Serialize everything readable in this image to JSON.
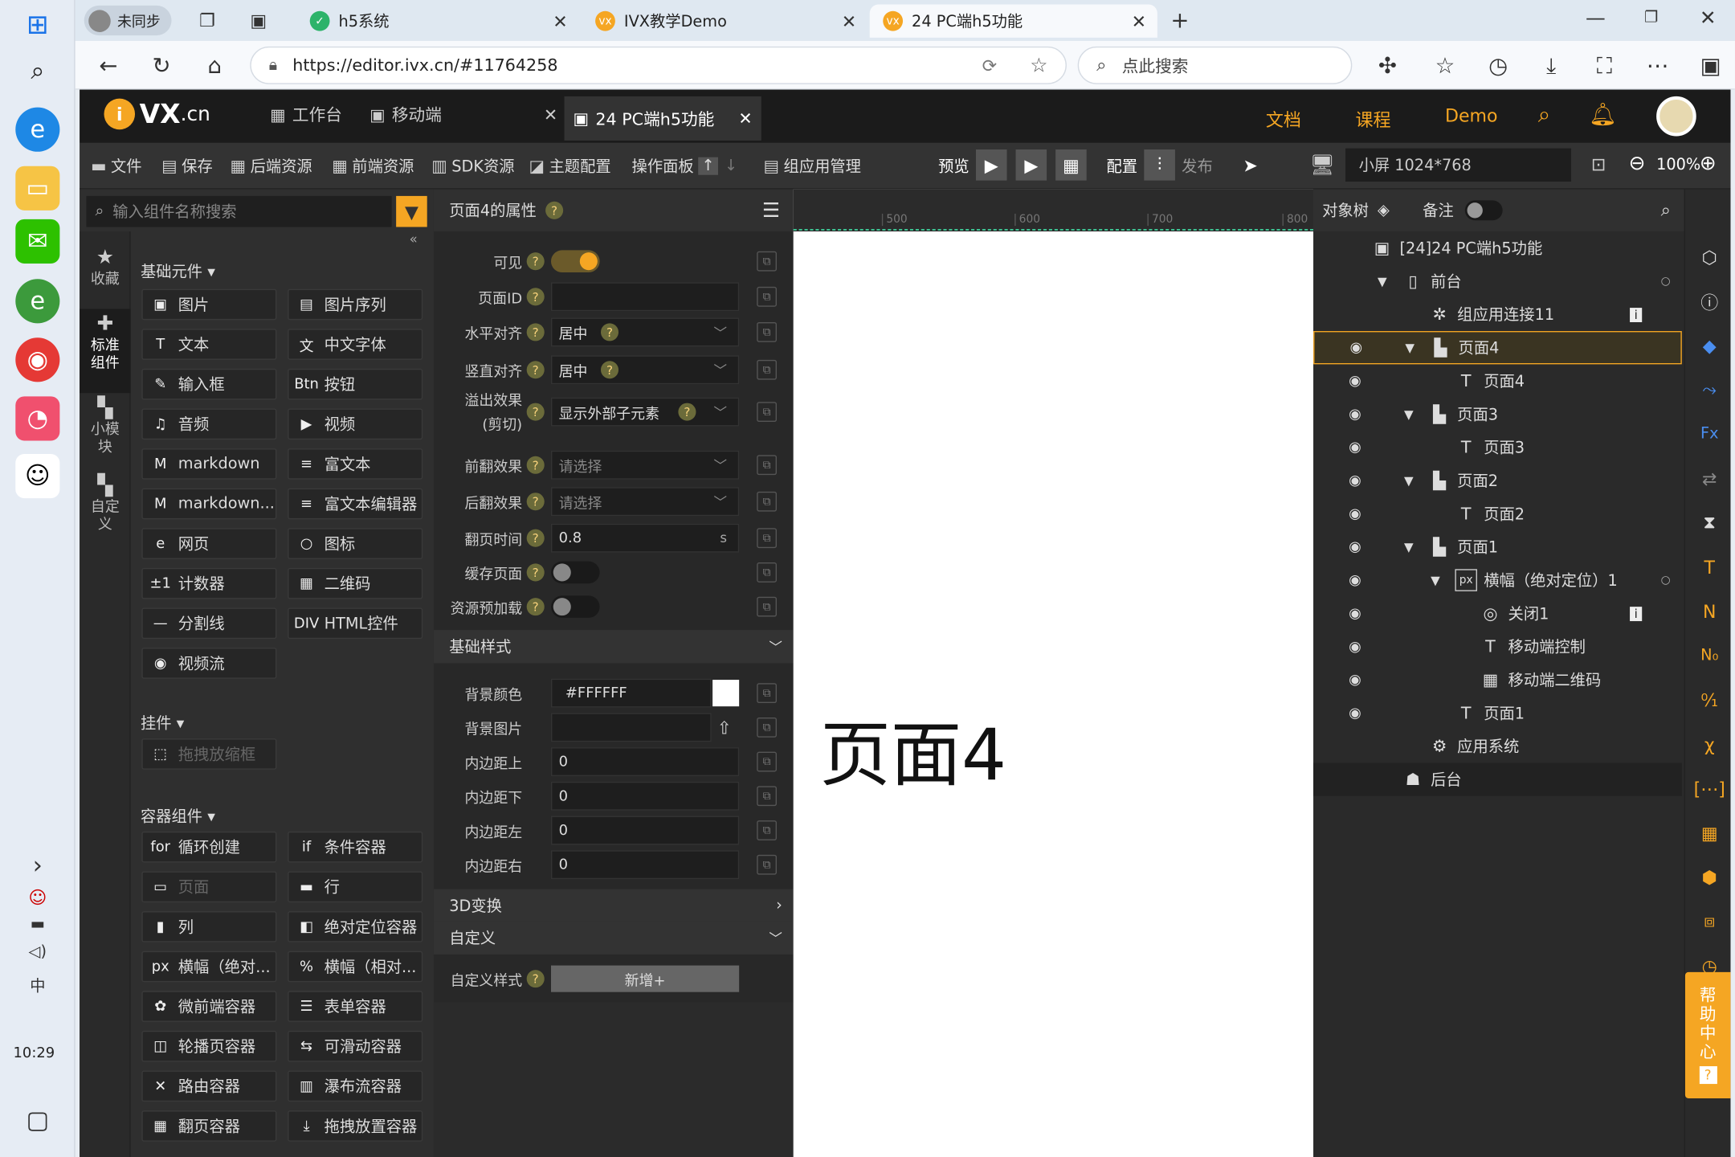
{
  "os": {
    "time": "10:29"
  },
  "browser": {
    "profile": "未同步",
    "tabs": [
      {
        "label": "h5系统"
      },
      {
        "label": "IVX教学Demo"
      },
      {
        "label": "24 PC端h5功能"
      }
    ],
    "url": "https://editor.ivx.cn/#11764258",
    "search_placeholder": "点此搜索"
  },
  "app": {
    "logo": "VX",
    "logo_suffix": ".cn",
    "header_tabs": [
      {
        "label": "工作台"
      },
      {
        "label": "移动端"
      },
      {
        "label": "24 PC端h5功能"
      }
    ],
    "header_links": [
      "文档",
      "课程",
      "Demo"
    ],
    "toolbar": {
      "file": "文件",
      "save": "保存",
      "backend": "后端资源",
      "frontend": "前端资源",
      "sdk": "SDK资源",
      "theme": "主题配置",
      "ops": "操作面板",
      "group": "组应用管理",
      "preview": "预览",
      "config": "配置",
      "publish": "发布",
      "screen": "小屏 1024*768",
      "zoom": "100%"
    },
    "search_placeholder": "输入组件名称搜索",
    "left_tabs": [
      {
        "label": "收藏"
      },
      {
        "label": "标准组件"
      },
      {
        "label": "小模块"
      },
      {
        "label": "自定义"
      }
    ],
    "sections": {
      "basic": "基础元件",
      "widgets": "挂件",
      "containers": "容器组件"
    },
    "basic_components": [
      {
        "label": "图片",
        "icon": "▣"
      },
      {
        "label": "图片序列",
        "icon": "▤"
      },
      {
        "label": "文本",
        "icon": "T"
      },
      {
        "label": "中文字体",
        "icon": "文"
      },
      {
        "label": "输入框",
        "icon": "✎"
      },
      {
        "label": "按钮",
        "icon": "Btn"
      },
      {
        "label": "音频",
        "icon": "♫"
      },
      {
        "label": "视频",
        "icon": "▶"
      },
      {
        "label": "markdown",
        "icon": "M"
      },
      {
        "label": "富文本",
        "icon": "≡"
      },
      {
        "label": "markdown...",
        "icon": "M"
      },
      {
        "label": "富文本编辑器",
        "icon": "≡"
      },
      {
        "label": "网页",
        "icon": "e"
      },
      {
        "label": "图标",
        "icon": "○"
      },
      {
        "label": "计数器",
        "icon": "±1"
      },
      {
        "label": "二维码",
        "icon": "▦"
      },
      {
        "label": "分割线",
        "icon": "—"
      },
      {
        "label": "HTML控件",
        "icon": "DIV"
      },
      {
        "label": "视频流",
        "icon": "◉"
      }
    ],
    "widget_components": [
      {
        "label": "拖拽放缩框",
        "icon": "⬚"
      }
    ],
    "container_components": [
      {
        "label": "循环创建",
        "icon": "for"
      },
      {
        "label": "条件容器",
        "icon": "if"
      },
      {
        "label": "页面",
        "icon": "▭"
      },
      {
        "label": "行",
        "icon": "▬"
      },
      {
        "label": "列",
        "icon": "▮"
      },
      {
        "label": "绝对定位容器",
        "icon": "◧"
      },
      {
        "label": "横幅（绝对...",
        "icon": "px"
      },
      {
        "label": "横幅（相对...",
        "icon": "%"
      },
      {
        "label": "微前端容器",
        "icon": "✿"
      },
      {
        "label": "表单容器",
        "icon": "☰"
      },
      {
        "label": "轮播页容器",
        "icon": "◫"
      },
      {
        "label": "可滑动容器",
        "icon": "⇆"
      },
      {
        "label": "路由容器",
        "icon": "✕"
      },
      {
        "label": "瀑布流容器",
        "icon": "▥"
      },
      {
        "label": "翻页容器",
        "icon": "▦"
      },
      {
        "label": "拖拽放置容器",
        "icon": "⤓"
      }
    ],
    "props": {
      "title": "页面4的属性",
      "visible": "可见",
      "page_id": "页面ID",
      "h_align": "水平对齐",
      "h_align_val": "居中",
      "v_align": "竖直对齐",
      "v_align_val": "居中",
      "overflow": "溢出效果",
      "overflow_sub": "(剪切)",
      "overflow_val": "显示外部子元素",
      "front_flip": "前翻效果",
      "back_flip": "后翻效果",
      "select_placeholder": "请选择",
      "flip_time": "翻页时间",
      "flip_time_val": "0.8",
      "flip_unit": "s",
      "cache": "缓存页面",
      "preload": "资源预加载",
      "base_style": "基础样式",
      "bg_color": "背景颜色",
      "bg_color_val": "#FFFFFF",
      "bg_image": "背景图片",
      "pad_top": "内边距上",
      "pad_bottom": "内边距下",
      "pad_left": "内边距左",
      "pad_right": "内边距右",
      "pad_val": "0",
      "transform3d": "3D变换",
      "custom": "自定义",
      "custom_style": "自定义样式",
      "add": "新增+"
    },
    "ruler_ticks": [
      "500",
      "600",
      "700",
      "800"
    ],
    "canvas_text": "页面4",
    "tree": {
      "tab": "对象树",
      "notes": "备注",
      "root": "[24]24 PC端h5功能",
      "front": "前台",
      "items": [
        "组应用连接11",
        "页面4",
        "页面4",
        "页面3",
        "页面3",
        "页面2",
        "页面2",
        "页面1",
        "横幅（绝对定位）1",
        "关闭1",
        "移动端控制",
        "移动端二维码",
        "页面1",
        "应用系统"
      ],
      "back": "后台"
    },
    "help": "帮助中心"
  }
}
